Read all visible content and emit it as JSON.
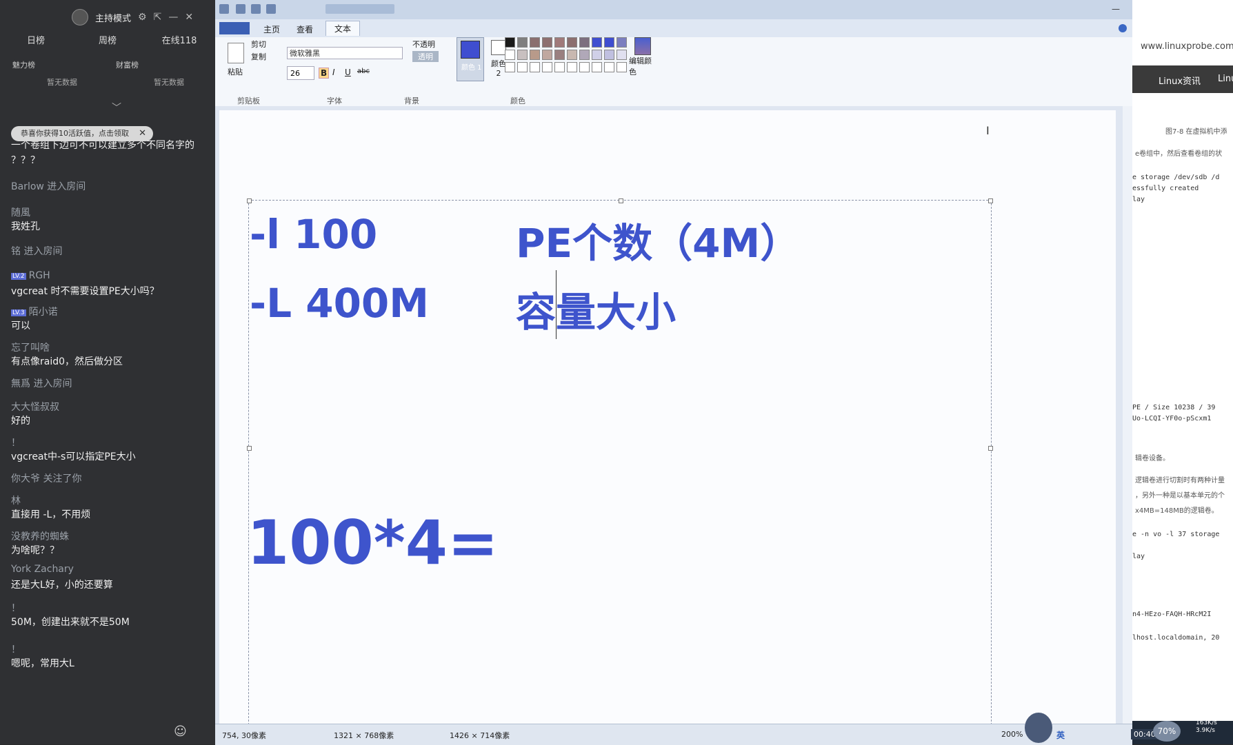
{
  "chat": {
    "title": "主持模式",
    "tabs": [
      "日榜",
      "周榜",
      "在线118"
    ],
    "rank_left": "魅力榜",
    "rank_right": "财富榜",
    "empty_left": "暂无数据",
    "empty_right": "暂无数据",
    "notice": "恭喜你获得10活跃值，点击领取",
    "messages": [
      {
        "nick": "",
        "text": "一个卷组下边可不可以建立多个不同名字的",
        "top": 0
      },
      {
        "nick": "",
        "text": "？？？",
        "top": 0
      },
      {
        "nick": "Barlow 进入房间",
        "text": "",
        "top": 0
      },
      {
        "nick": "随風",
        "text": "我姓孔",
        "top": 0
      },
      {
        "nick": "铭 进入房间",
        "text": "",
        "top": 0
      },
      {
        "nick": "RGH",
        "level": "LV.2",
        "text": "vgcreat 时不需要设置PE大小吗？",
        "top": 0
      },
      {
        "nick": "陌小诺",
        "level": "LV.3",
        "text": "可以",
        "top": 0
      },
      {
        "nick": "忘了叫啥",
        "text": "有点像raid0，然后做分区",
        "top": 0
      },
      {
        "nick": "無爲 进入房间",
        "text": "",
        "top": 0
      },
      {
        "nick": "大大怪叔叔",
        "text": "好的",
        "top": 0
      },
      {
        "nick": "！",
        "text": "vgcreat中-s可以指定PE大小",
        "top": 0
      },
      {
        "nick": "你大爷 关注了你",
        "text": "",
        "top": 0
      },
      {
        "nick": "林",
        "text": "直接用 -L，不用烦",
        "top": 0
      },
      {
        "nick": "没教养的蜘蛛",
        "text": "为啥呢？？",
        "top": 0
      },
      {
        "nick": "York Zachary",
        "text": "还是大L好，小的还要算",
        "top": 0
      },
      {
        "nick": "！",
        "text": "50M，创建出来就不是50M",
        "top": 0
      },
      {
        "nick": "！",
        "text": "嗯呢，常用大L",
        "top": 0
      }
    ]
  },
  "paint": {
    "tabs": [
      "主页",
      "查看",
      "文本"
    ],
    "active_tab": "文本",
    "clipboard": {
      "paste": "粘贴",
      "cut": "剪切",
      "copy": "复制",
      "group": "剪贴板"
    },
    "font": {
      "name": "微软雅黑",
      "size": "26",
      "group": "字体",
      "bold": "B",
      "italic": "I",
      "underline": "U",
      "strike": "abc"
    },
    "background": {
      "opaque": "不透明",
      "transparent": "透明",
      "group": "背景"
    },
    "colors": {
      "color1_label": "颜色 1",
      "color2_label": "颜色 2",
      "edit": "编辑颜色",
      "group": "颜色",
      "color1": "#3f4ed0",
      "color2": "#ffffff"
    },
    "canvas_text": {
      "line1_left": "-l   100",
      "line1_right": "PE个数（4M）",
      "line2_left": "-L  400M",
      "line2_right": "容量大小",
      "line3": "100*4="
    },
    "status": {
      "cursor": "754, 30像素",
      "selection": "1321 × 768像素",
      "size": "1426 × 714像素",
      "zoom": "200%"
    }
  },
  "web": {
    "url": "www.linuxprobe.com/",
    "nav1": "Linux资讯",
    "nav2": "Linu",
    "caption": "图7-8 在虚拟机中添",
    "lines": [
      "e卷组中，然后查看卷组的状",
      "e storage /dev/sdb /d",
      "essfully created",
      "lay",
      "PE / Size 10238 / 39",
      "Uo-LCQI-YF0o-pScxm1",
      "辑卷设备。",
      "逻辑卷进行切割时有两种计量",
      "，另外一种是以基本单元的个",
      "x4MB=148MB的逻辑卷。",
      "e -n vo -l 37 storage",
      "lay",
      "n4-HEzo-FAQH-HRcM2I",
      "lhost.localdomain, 20"
    ]
  },
  "taskbar": {
    "ime": "英",
    "time": "00:40",
    "percent": "70%",
    "speed_up": "163K/s",
    "speed_down": "3.9K/s"
  }
}
